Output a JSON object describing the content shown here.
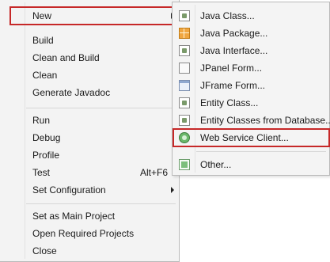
{
  "main_menu": {
    "items": [
      {
        "label": "New",
        "shortcut": "",
        "submenu": true
      },
      {
        "label": "Build",
        "shortcut": "",
        "submenu": false
      },
      {
        "label": "Clean and Build",
        "shortcut": "",
        "submenu": false
      },
      {
        "label": "Clean",
        "shortcut": "",
        "submenu": false
      },
      {
        "label": "Generate Javadoc",
        "shortcut": "",
        "submenu": false
      },
      {
        "label": "Run",
        "shortcut": "",
        "submenu": false
      },
      {
        "label": "Debug",
        "shortcut": "",
        "submenu": false
      },
      {
        "label": "Profile",
        "shortcut": "",
        "submenu": false
      },
      {
        "label": "Test",
        "shortcut": "Alt+F6",
        "submenu": false
      },
      {
        "label": "Set Configuration",
        "shortcut": "",
        "submenu": true
      },
      {
        "label": "Set as Main Project",
        "shortcut": "",
        "submenu": false
      },
      {
        "label": "Open Required Projects",
        "shortcut": "",
        "submenu": false
      },
      {
        "label": "Close",
        "shortcut": "",
        "submenu": false
      }
    ]
  },
  "sub_menu": {
    "items": [
      {
        "label": "Java Class...",
        "icon": "java-class-icon"
      },
      {
        "label": "Java Package...",
        "icon": "java-package-icon"
      },
      {
        "label": "Java Interface...",
        "icon": "java-interface-icon"
      },
      {
        "label": "JPanel Form...",
        "icon": "jpanel-form-icon"
      },
      {
        "label": "JFrame Form...",
        "icon": "jframe-form-icon"
      },
      {
        "label": "Entity Class...",
        "icon": "entity-class-icon"
      },
      {
        "label": "Entity Classes from Database...",
        "icon": "entity-database-icon"
      },
      {
        "label": "Web Service Client...",
        "icon": "web-service-client-icon"
      },
      {
        "label": "Other...",
        "icon": "other-icon"
      }
    ]
  },
  "colors": {
    "highlight_border": "#c62828",
    "menu_background": "#f4f4f4"
  }
}
